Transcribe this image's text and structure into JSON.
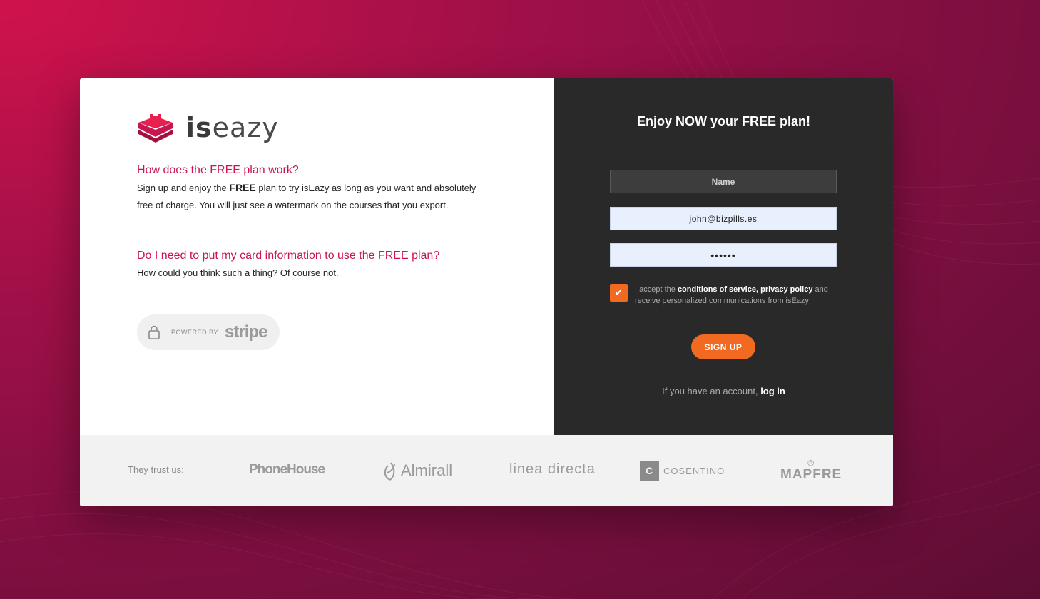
{
  "left": {
    "logo_text_bold": "is",
    "logo_text_light": "eazy",
    "faq": [
      {
        "question": "How does the FREE plan work?",
        "answer_pre": "Sign up and enjoy the ",
        "answer_bold": "FREE",
        "answer_post": " plan to try isEazy as long as you want and absolutely free of charge. You will just see a watermark on the courses that you export."
      },
      {
        "question": "Do I need to put my card information to use the FREE plan?",
        "answer": "How could you think such a thing? Of course not."
      }
    ],
    "stripe": {
      "powered_by": "POWERED BY",
      "brand": "stripe"
    }
  },
  "form": {
    "title": "Enjoy NOW your FREE plan!",
    "name_placeholder": "Name",
    "email_value": "john@bizpills.es",
    "password_value": "••••••",
    "terms_checked": true,
    "terms_pre": "I accept the ",
    "terms_link1": "conditions of service",
    "terms_sep": ", ",
    "terms_link2": "privacy policy",
    "terms_post": " and receive personalized communications from isEazy",
    "signup_label": "SIGN UP",
    "login_pre": "If you have an account, ",
    "login_link": "log in"
  },
  "footer": {
    "trust_label": "They trust us:",
    "brands": {
      "phonehouse": "PhoneHouse",
      "almirall": "Almirall",
      "lineadirecta": "linea directa",
      "cosentino": "COSENTINO",
      "cosentino_mark": "C",
      "mapfre": "MAPFRE"
    }
  },
  "colors": {
    "accent": "#c8174f",
    "orange": "#f26a21",
    "dark_panel": "#292929"
  }
}
